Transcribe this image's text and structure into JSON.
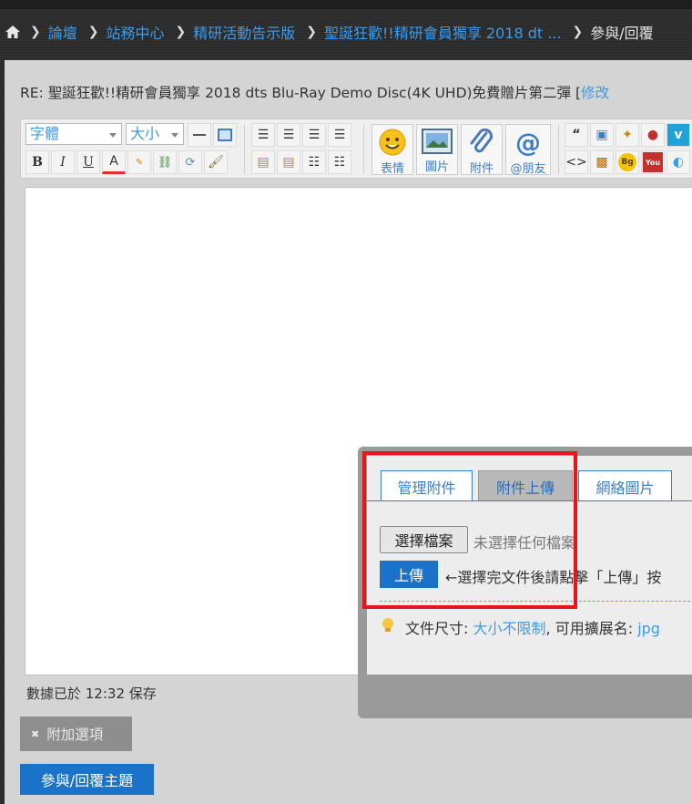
{
  "breadcrumb": {
    "items": [
      "論壇",
      "站務中心",
      "精研活動告示版",
      "聖誕狂歡!!精研會員獨享 2018 dt ..."
    ],
    "current": "參與/回覆"
  },
  "post": {
    "title_prefix": "RE: 聖誕狂歡!!精研會員獨享 2018 dts Blu-Ray Demo Disc(4K UHD)免費贈片第二彈 [",
    "title_link": "修改"
  },
  "toolbar": {
    "font_select": "字體",
    "size_select": "大小",
    "format_buttons": [
      "B",
      "I",
      "U",
      "A"
    ],
    "big_buttons": [
      "表情",
      "圖片",
      "附件",
      "@朋友"
    ]
  },
  "editor": {
    "saved_note": "數據已於 12:32 保存"
  },
  "options_button": "附加選項",
  "submit_button": "參與/回覆主題",
  "attach_popup": {
    "tabs": [
      "管理附件",
      "附件上傳",
      "網絡圖片"
    ],
    "choose_file": "選擇檔案",
    "no_file": "未選擇任何檔案",
    "upload": "上傳",
    "upload_hint": "←選擇完文件後請點擊「上傳」按",
    "file_size_label": "文件尺寸:",
    "file_size_value": "大小不限制",
    "ext_label": ", 可用擴展名:",
    "ext_value": "jpg"
  },
  "colors": {
    "link": "#3d9be8",
    "primary_button": "#1a73c8",
    "highlight": "#e4161c"
  }
}
